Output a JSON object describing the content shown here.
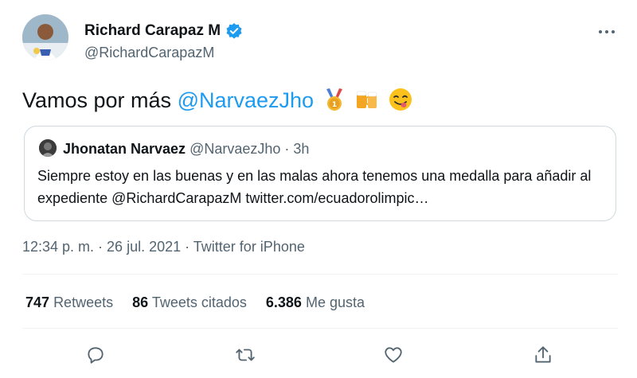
{
  "author": {
    "name": "Richard Carapaz M",
    "handle": "@RichardCarapazM",
    "verified_icon": "verified-badge-icon"
  },
  "tweet": {
    "text_prefix": "Vamos por más ",
    "mention": "@NarvaezJho",
    "emojis": [
      "medal-icon",
      "beer-mugs-icon",
      "yum-face-icon"
    ]
  },
  "quote": {
    "name": "Jhonatan Narvaez",
    "handle": "@NarvaezJho",
    "separator": " · ",
    "time": "3h",
    "text": "Siempre estoy en las buenas y en las malas ahora tenemos una medalla para añadir al expediente @RichardCarapazM twitter.com/ecuadorolimpic…"
  },
  "timestamp": "12:34 p. m. · 26 jul. 2021 · Twitter for iPhone",
  "stats": {
    "retweets": {
      "value": "747",
      "label": "Retweets"
    },
    "quotes": {
      "value": "86",
      "label": "Tweets citados"
    },
    "likes": {
      "value": "6.386",
      "label": "Me gusta"
    }
  },
  "actions": [
    "reply-icon",
    "retweet-icon",
    "like-icon",
    "share-icon"
  ],
  "colors": {
    "link": "#1d9bf0",
    "secondary": "#536471",
    "border": "#cfd9de"
  }
}
